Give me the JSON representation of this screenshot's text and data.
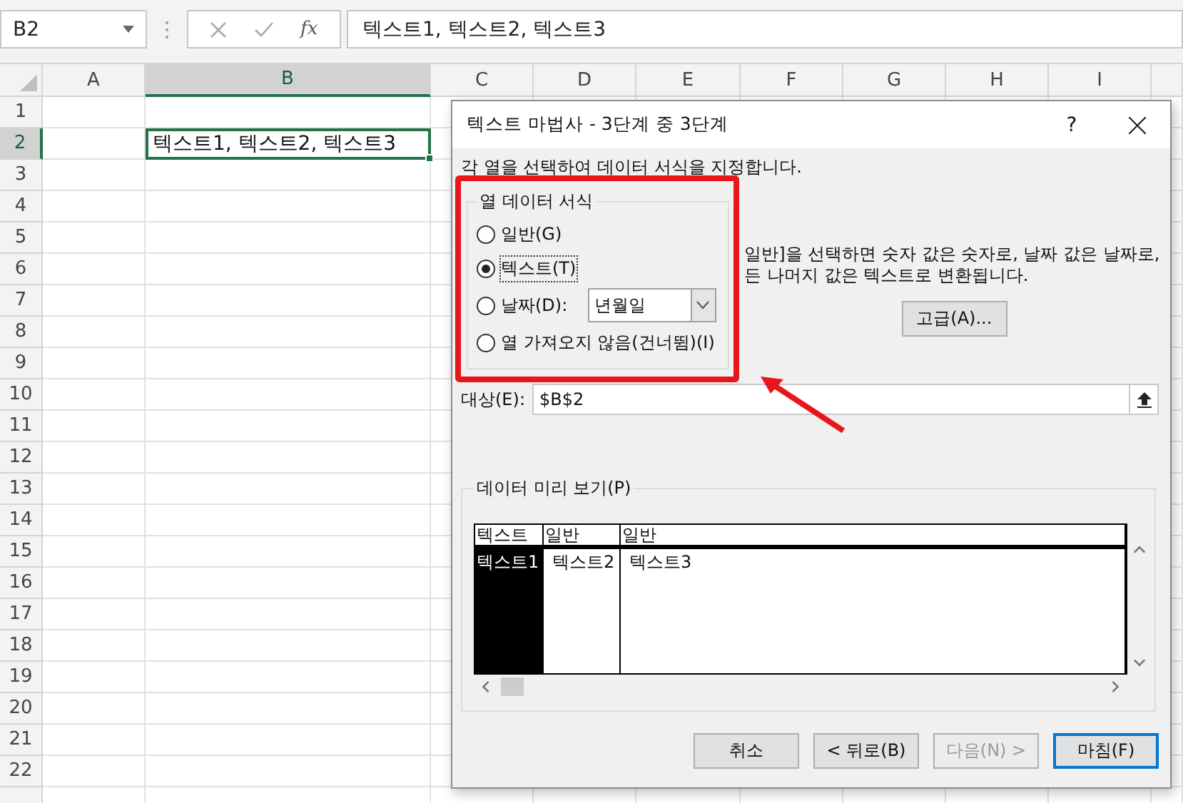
{
  "formula_bar": {
    "name_box": "B2",
    "function_label": "fx",
    "formula": "텍스트1, 텍스트2, 텍스트3"
  },
  "sheet": {
    "columns": [
      {
        "label": "A",
        "selected": false
      },
      {
        "label": "B",
        "selected": true
      },
      {
        "label": "C",
        "selected": false
      },
      {
        "label": "D",
        "selected": false
      },
      {
        "label": "E",
        "selected": false
      },
      {
        "label": "F",
        "selected": false
      },
      {
        "label": "G",
        "selected": false
      },
      {
        "label": "H",
        "selected": false
      },
      {
        "label": "I",
        "selected": false
      }
    ],
    "rows": [
      {
        "label": "1",
        "selected": false
      },
      {
        "label": "2",
        "selected": true
      },
      {
        "label": "3",
        "selected": false
      },
      {
        "label": "4",
        "selected": false
      },
      {
        "label": "5",
        "selected": false
      },
      {
        "label": "6",
        "selected": false
      },
      {
        "label": "7",
        "selected": false
      },
      {
        "label": "8",
        "selected": false
      },
      {
        "label": "9",
        "selected": false
      },
      {
        "label": "10",
        "selected": false
      },
      {
        "label": "11",
        "selected": false
      },
      {
        "label": "12",
        "selected": false
      },
      {
        "label": "13",
        "selected": false
      },
      {
        "label": "14",
        "selected": false
      },
      {
        "label": "15",
        "selected": false
      },
      {
        "label": "16",
        "selected": false
      },
      {
        "label": "17",
        "selected": false
      },
      {
        "label": "18",
        "selected": false
      },
      {
        "label": "19",
        "selected": false
      },
      {
        "label": "20",
        "selected": false
      },
      {
        "label": "21",
        "selected": false
      },
      {
        "label": "22",
        "selected": false
      }
    ],
    "active_cell": {
      "value": "텍스트1, 텍스트2, 텍스트3"
    }
  },
  "dialog": {
    "title": "텍스트 마법사 - 3단계 중 3단계",
    "help": "?",
    "description": "각 열을 선택하여 데이터 서식을 지정합니다.",
    "format_group": {
      "legend": "열 데이터 서식",
      "options": [
        {
          "kind": "plain",
          "label": "일반(G)",
          "selected": false
        },
        {
          "kind": "plain",
          "label": "텍스트(T)",
          "selected": true
        },
        {
          "kind": "date",
          "label": "날짜(D):",
          "value": "년월일",
          "selected": false
        },
        {
          "kind": "plain",
          "label": "열 가져오지 않음(건너뜀)(I)",
          "selected": false
        }
      ]
    },
    "hint_lines": [
      "일반]을 선택하면 숫자 값은 숫자로, 날짜 값은 날짜로,",
      "든 나머지 값은 텍스트로 변환됩니다."
    ],
    "advanced_button": "고급(A)...",
    "destination": {
      "label": "대상(E):",
      "value": "$B$2"
    },
    "preview": {
      "legend": "데이터 미리 보기(P)",
      "columns": [
        {
          "header": "텍스트",
          "cells": [
            "텍스트1"
          ],
          "selected": true
        },
        {
          "header": "일반",
          "cells": [
            "텍스트2"
          ],
          "selected": false
        },
        {
          "header": "일반",
          "cells": [
            "텍스트3"
          ],
          "selected": false
        }
      ]
    },
    "buttons": [
      {
        "label": "취소",
        "disabled": false,
        "default": false
      },
      {
        "label": "< 뒤로(B)",
        "disabled": false,
        "default": false
      },
      {
        "label": "다음(N) >",
        "disabled": true,
        "default": false
      },
      {
        "label": "마침(F)",
        "disabled": false,
        "default": true
      }
    ]
  }
}
